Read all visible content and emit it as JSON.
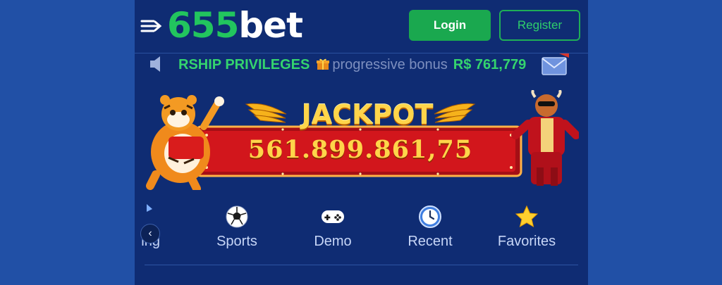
{
  "header": {
    "logo_number": "655",
    "logo_word": "bet",
    "login_label": "Login",
    "register_label": "Register"
  },
  "marquee": {
    "text_strong": "RSHIP PRIVILEGES",
    "text_soft": "progressive bonus",
    "amount": "R$ 761,779"
  },
  "jackpot": {
    "title": "JACKPOT",
    "value": "561.899.861,75"
  },
  "categories": {
    "partial_label": "ing",
    "items": [
      {
        "label": "Sports",
        "icon": "soccer-ball-icon"
      },
      {
        "label": "Demo",
        "icon": "gamepad-icon"
      },
      {
        "label": "Recent",
        "icon": "clock-icon"
      },
      {
        "label": "Favorites",
        "icon": "star-icon"
      }
    ]
  },
  "colors": {
    "page_background": "#2150a6",
    "app_background": "#0f2c73",
    "accent_green": "#1aa84f",
    "jackpot_gold": "#ffd54a",
    "jackpot_red": "#c8141a"
  }
}
